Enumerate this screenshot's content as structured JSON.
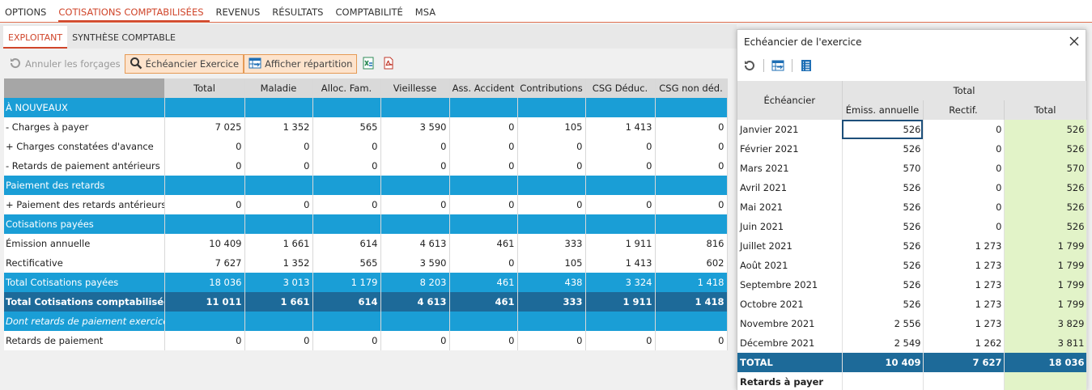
{
  "topnav": [
    "OPTIONS",
    "COTISATIONS COMPTABILISÉES",
    "REVENUS",
    "RÉSULTATS",
    "COMPTABILITÉ",
    "MSA"
  ],
  "subtabs": [
    "EXPLOITANT",
    "SYNTHÈSE COMPTABLE"
  ],
  "toolbar": {
    "undo_label": "Annuler les forçages",
    "echeancier_label": "Échéancier Exercice",
    "repartition_label": "Afficher répartition"
  },
  "table": {
    "headers": [
      "Total",
      "Maladie",
      "Alloc. Fam.",
      "Vieillesse",
      "Ass. Accident",
      "Contributions",
      "CSG Déduc.",
      "CSG non déd."
    ],
    "rows": [
      {
        "type": "section",
        "label": "À NOUVEAUX",
        "values": []
      },
      {
        "type": "data",
        "label": "- Charges à payer",
        "values": [
          "7 025",
          "1 352",
          "565",
          "3 590",
          "0",
          "105",
          "1 413",
          "0"
        ]
      },
      {
        "type": "data",
        "label": "+ Charges constatées d'avance",
        "values": [
          "0",
          "0",
          "0",
          "0",
          "0",
          "0",
          "0",
          "0"
        ]
      },
      {
        "type": "data",
        "label": "- Retards de paiement antérieurs",
        "values": [
          "0",
          "0",
          "0",
          "0",
          "0",
          "0",
          "0",
          "0"
        ]
      },
      {
        "type": "section",
        "label": "Paiement des retards",
        "values": []
      },
      {
        "type": "data",
        "label": "+ Paiement des retards antérieurs",
        "values": [
          "0",
          "0",
          "0",
          "0",
          "0",
          "0",
          "0",
          "0"
        ]
      },
      {
        "type": "section",
        "label": "Cotisations payées",
        "values": []
      },
      {
        "type": "data",
        "label": "Émission annuelle",
        "values": [
          "10 409",
          "1 661",
          "614",
          "4 613",
          "461",
          "333",
          "1 911",
          "816"
        ]
      },
      {
        "type": "data",
        "label": "Rectificative",
        "values": [
          "7 627",
          "1 352",
          "565",
          "3 590",
          "0",
          "105",
          "1 413",
          "602"
        ]
      },
      {
        "type": "total",
        "label": "Total Cotisations payées",
        "values": [
          "18 036",
          "3 013",
          "1 179",
          "8 203",
          "461",
          "438",
          "3 324",
          "1 418"
        ]
      },
      {
        "type": "grand",
        "label": "Total Cotisations comptabilisées",
        "values": [
          "11 011",
          "1 661",
          "614",
          "4 613",
          "461",
          "333",
          "1 911",
          "1 418"
        ]
      },
      {
        "type": "italic",
        "label": "Dont retards de paiement exercice",
        "values": []
      },
      {
        "type": "data",
        "label": "Retards de paiement",
        "values": [
          "0",
          "0",
          "0",
          "0",
          "0",
          "0",
          "0",
          "0"
        ]
      }
    ]
  },
  "panel": {
    "title": "Echéancier de l'exercice",
    "col_echeancier": "Échéancier",
    "col_group": "Total",
    "col_emiss": "Émiss. annuelle",
    "col_rectif": "Rectif.",
    "col_total": "Total",
    "rows": [
      {
        "label": "Janvier 2021",
        "emiss": "526",
        "rectif": "0",
        "total": "526"
      },
      {
        "label": "Février 2021",
        "emiss": "526",
        "rectif": "0",
        "total": "526"
      },
      {
        "label": "Mars 2021",
        "emiss": "570",
        "rectif": "0",
        "total": "570"
      },
      {
        "label": "Avril 2021",
        "emiss": "526",
        "rectif": "0",
        "total": "526"
      },
      {
        "label": "Mai 2021",
        "emiss": "526",
        "rectif": "0",
        "total": "526"
      },
      {
        "label": "Juin 2021",
        "emiss": "526",
        "rectif": "0",
        "total": "526"
      },
      {
        "label": "Juillet 2021",
        "emiss": "526",
        "rectif": "1 273",
        "total": "1 799"
      },
      {
        "label": "Août 2021",
        "emiss": "526",
        "rectif": "1 273",
        "total": "1 799"
      },
      {
        "label": "Septembre 2021",
        "emiss": "526",
        "rectif": "1 273",
        "total": "1 799"
      },
      {
        "label": "Octobre 2021",
        "emiss": "526",
        "rectif": "1 273",
        "total": "1 799"
      },
      {
        "label": "Novembre 2021",
        "emiss": "2 556",
        "rectif": "1 273",
        "total": "3 829"
      },
      {
        "label": "Décembre 2021",
        "emiss": "2 549",
        "rectif": "1 262",
        "total": "3 811"
      }
    ],
    "total_row": {
      "label": "TOTAL",
      "emiss": "10 409",
      "rectif": "7 627",
      "total": "18 036"
    },
    "last_row_label": "Retards à payer"
  }
}
